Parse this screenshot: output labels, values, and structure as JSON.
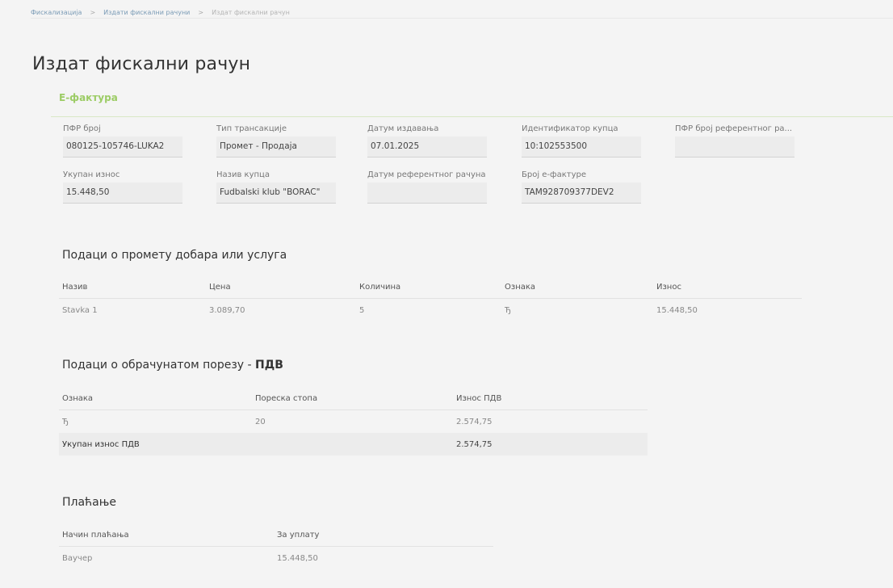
{
  "breadcrumb": {
    "items": [
      "Фискализација",
      "Издати фискални рачуни"
    ],
    "current": "Издат фискални рачун",
    "separator": ">"
  },
  "page": {
    "title": "Издат фискални рачун",
    "section": "Е-фактура"
  },
  "fields": {
    "pfr_broj": {
      "label": "ПФР број",
      "value": "080125-105746-LUKA2"
    },
    "tip_transakcije": {
      "label": "Тип трансакције",
      "value": "Промет - Продаја"
    },
    "datum_izdavanja": {
      "label": "Датум издавања",
      "value": "07.01.2025"
    },
    "identifikator_kupca": {
      "label": "Идентификатор купца",
      "value": "10:102553500"
    },
    "pfr_referentni": {
      "label": "ПФР број референтног ра...",
      "value": ""
    },
    "ukupan_iznos": {
      "label": "Укупан износ",
      "value": "15.448,50"
    },
    "naziv_kupca": {
      "label": "Назив купца",
      "value": "Fudbalski klub \"BORAC\""
    },
    "datum_referentnog": {
      "label": "Датум референтног рачуна",
      "value": ""
    },
    "broj_efakture": {
      "label": "Број е-фактуре",
      "value": "TAM928709377DEV2"
    }
  },
  "promet": {
    "title": "Подаци о промету добара или услуга",
    "headers": [
      "Назив",
      "Цена",
      "Количина",
      "Ознака",
      "Износ"
    ],
    "rows": [
      [
        "Stavka 1",
        "3.089,70",
        "5",
        "Ђ",
        "15.448,50"
      ]
    ]
  },
  "porez": {
    "title_plain": "Подаци о обрачунатом порезу - ",
    "title_bold": "ПДВ",
    "headers": [
      "Ознака",
      "Пореска стопа",
      "Износ ПДВ"
    ],
    "rows": [
      [
        "Ђ",
        "20",
        "2.574,75"
      ]
    ],
    "total_label": "Укупан износ ПДВ",
    "total_value": "2.574,75"
  },
  "placanje": {
    "title": "Плаћање",
    "headers": [
      "Начин плаћања",
      "За уплату"
    ],
    "rows": [
      [
        "Ваучер",
        "15.448,50"
      ]
    ]
  }
}
